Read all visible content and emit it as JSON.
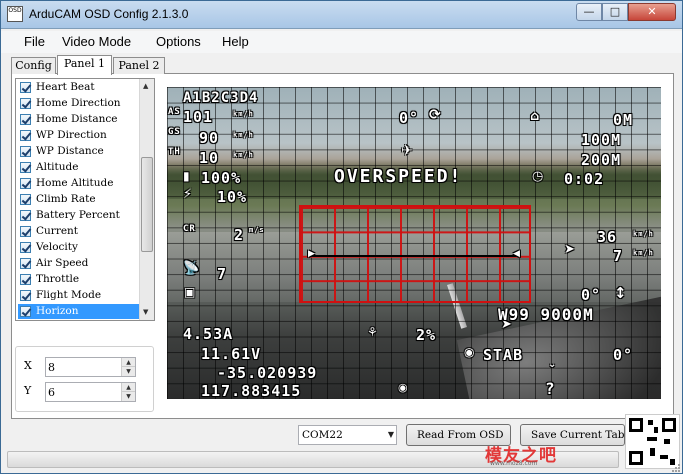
{
  "window": {
    "title": "ArduCAM OSD Config 2.1.3.0",
    "icon_label": "OSD",
    "buttons": [
      "minimize-icon",
      "maximize-icon",
      "close-icon"
    ]
  },
  "menu": [
    "File",
    "Video Mode",
    "Options",
    "Help"
  ],
  "tabs": [
    {
      "label": "Config",
      "active": false
    },
    {
      "label": "Panel 1",
      "active": true
    },
    {
      "label": "Panel 2",
      "active": false
    }
  ],
  "panel_list": {
    "items": [
      {
        "label": "Heart Beat",
        "checked": true
      },
      {
        "label": "Home Direction",
        "checked": true
      },
      {
        "label": "Home Distance",
        "checked": true
      },
      {
        "label": "WP Direction",
        "checked": true
      },
      {
        "label": "WP Distance",
        "checked": true
      },
      {
        "label": "Altitude",
        "checked": true
      },
      {
        "label": "Home Altitude",
        "checked": true
      },
      {
        "label": "Climb Rate",
        "checked": true
      },
      {
        "label": "Battery Percent",
        "checked": true
      },
      {
        "label": "Current",
        "checked": true
      },
      {
        "label": "Velocity",
        "checked": true
      },
      {
        "label": "Air Speed",
        "checked": true
      },
      {
        "label": "Throttle",
        "checked": true
      },
      {
        "label": "Flight Mode",
        "checked": true
      },
      {
        "label": "Horizon",
        "checked": true,
        "selected": true
      }
    ]
  },
  "position": {
    "x_label": "X",
    "x_value": "8",
    "y_label": "Y",
    "y_value": "6"
  },
  "osd": {
    "header": "A1B2C3D4",
    "left_col": [
      "101",
      "90",
      "10",
      "100%",
      "10%"
    ],
    "left_units": [
      "km/h",
      "km/h",
      "km/h",
      "",
      ""
    ],
    "left_prefix": [
      "AS",
      "GS",
      "TH",
      "",
      ""
    ],
    "heading": "0°",
    "overspeed": "OVERSPEED!",
    "home_dist": "0M",
    "home_alt": "100M",
    "alt": "200M",
    "time": "0:02",
    "climb_prefix": "CR",
    "climb": "2",
    "climb_unit": "m/s",
    "sats": "7",
    "wind": "36",
    "wind_unit": "km/h",
    "wind_dir": "7",
    "wind_dir_unit": "km/h",
    "pitch": "0°",
    "waypoint": "W99 9000M",
    "current": "4.53A",
    "rssi": "2%",
    "voltage": "11.61V",
    "mode": "STAB",
    "roll": "0°",
    "lat": "-35.020939",
    "lon": "117.883415",
    "unknown": "?"
  },
  "status": {
    "com_port": "COM22",
    "read_button": "Read From OSD",
    "save_button": "Save Current Tab"
  },
  "watermark": {
    "text": "模友之吧",
    "url": "www.moz8.com"
  }
}
